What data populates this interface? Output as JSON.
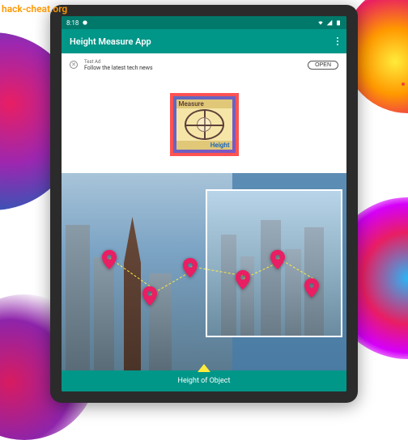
{
  "watermark": "hack-cheat.org",
  "status": {
    "time": "8:18",
    "battery_icon": "battery",
    "wifi_icon": "wifi",
    "signal_icon": "signal"
  },
  "appbar": {
    "title": "Height Measure App",
    "menu_icon": "more-vert"
  },
  "ad": {
    "label": "Test Ad",
    "description": "Follow the latest tech news",
    "button": "OPEN",
    "close_icon": "close"
  },
  "logo": {
    "top_text": "Measure",
    "bottom_text": "Height"
  },
  "bottom": {
    "label": "Height of Object"
  }
}
